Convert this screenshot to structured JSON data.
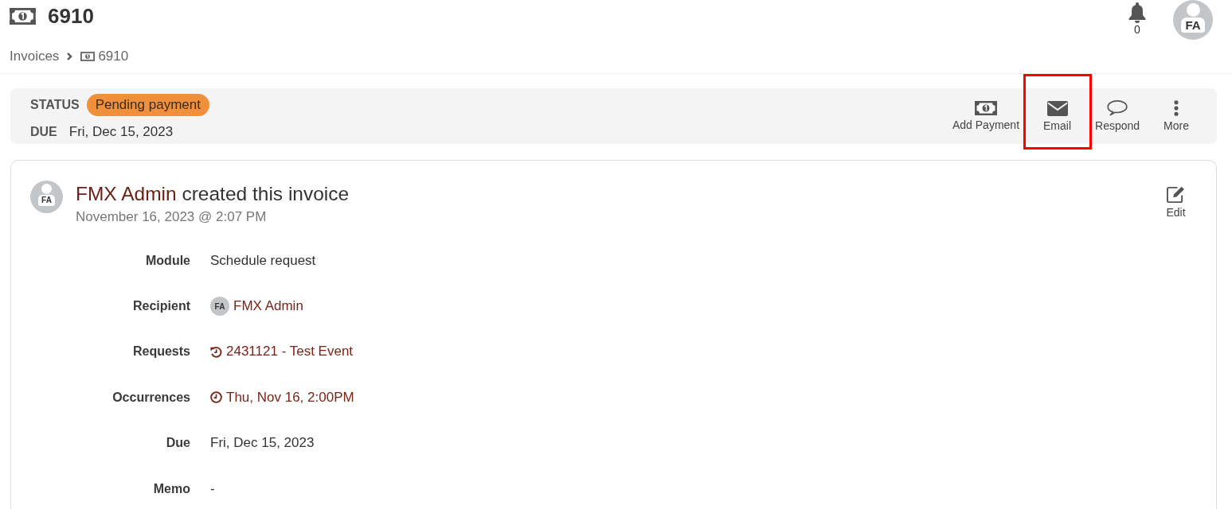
{
  "header": {
    "title": "6910",
    "notifications": "0",
    "avatar_initials": "FA"
  },
  "breadcrumb": [
    {
      "label": "Invoices",
      "kind": "link"
    },
    {
      "label": "6910",
      "kind": "invoice"
    }
  ],
  "status_bar": {
    "status_label": "STATUS",
    "status": "Pending payment",
    "due_label": "DUE",
    "due": "Fri, Dec 15, 2023"
  },
  "actions": [
    {
      "label": "Add Payment",
      "kind": "payment",
      "highlighted": false
    },
    {
      "label": "Email",
      "kind": "email",
      "highlighted": true
    },
    {
      "label": "Respond",
      "kind": "respond",
      "highlighted": false
    },
    {
      "label": "More",
      "kind": "more",
      "highlighted": false
    }
  ],
  "activity": {
    "author": "FMX Admin",
    "action": "created this invoice",
    "avatar_initials": "FA",
    "timestamp": "November 16, 2023 @ 2:07 PM",
    "edit_label": "Edit"
  },
  "details": [
    {
      "label": "Module",
      "value": "Schedule request",
      "kind": "text"
    },
    {
      "label": "Recipient",
      "value": "FMX Admin",
      "avatar_initials": "FA",
      "kind": "user"
    },
    {
      "label": "Requests",
      "value": "2431121 - Test Event",
      "kind": "request"
    },
    {
      "label": "Occurrences",
      "value": "Thu, Nov 16, 2:00PM",
      "kind": "occurrence"
    },
    {
      "label": "Due",
      "value": "Fri, Dec 15, 2023",
      "kind": "text"
    },
    {
      "label": "Memo",
      "value": "-",
      "kind": "text"
    }
  ]
}
